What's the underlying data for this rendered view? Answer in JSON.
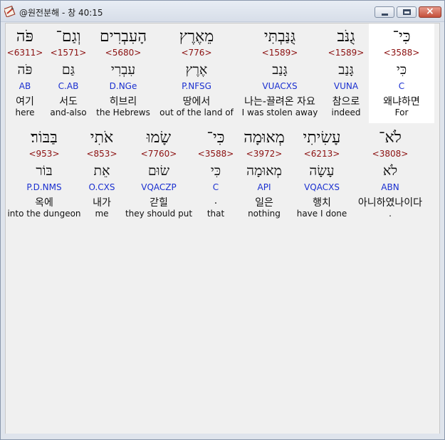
{
  "window": {
    "title": "@원전분해 - 창 40:15",
    "buttons": {
      "minimize": "minimize",
      "maximize": "maximize",
      "close": "×"
    }
  },
  "rows": [
    {
      "words": [
        {
          "heb": "כִּי־",
          "strong": "<3588>",
          "lex": "כִּי",
          "parse": "C",
          "kor": "왜냐하면",
          "eng": "For",
          "selected": true
        },
        {
          "heb": "גֻנֹּב",
          "strong": "<1589>",
          "lex": "גָּנַב",
          "parse": "VUNA",
          "kor": "참으로",
          "eng": "indeed"
        },
        {
          "heb": "גֻּנַּבְתִּי",
          "strong": "<1589>",
          "lex": "גָּנַב",
          "parse": "VUACXS",
          "kor": "나는-끌려온 자요",
          "eng": "I was stolen away"
        },
        {
          "heb": "מֵאֶרֶץ",
          "strong": "<776>",
          "lex": "אֶרֶץ",
          "parse": "P.NFSG",
          "kor": "땅에서",
          "eng": "out of the land of"
        },
        {
          "heb": "הָעִבְרִים",
          "strong": "<5680>",
          "lex": "עִבְרִי",
          "parse": "D.NGe",
          "kor": "히브리",
          "eng": "the Hebrews"
        },
        {
          "heb": "וְגַם־",
          "strong": "<1571>",
          "lex": "גַּם",
          "parse": "C.AB",
          "kor": "서도",
          "eng": "and-also"
        },
        {
          "heb": "פֹּה",
          "strong": "<6311>",
          "lex": "פֹּה",
          "parse": "AB",
          "kor": "여기",
          "eng": "here"
        }
      ]
    },
    {
      "words": [
        {
          "heb": "לֹא־",
          "strong": "<3808>",
          "lex": "לֹא",
          "parse": "ABN",
          "kor": "아니하였나이다",
          "eng": "."
        },
        {
          "heb": "עָשִׂיתִי",
          "strong": "<6213>",
          "lex": "עָשָׂה",
          "parse": "VQACXS",
          "kor": "행치",
          "eng": "have I done"
        },
        {
          "heb": "מְאוּמָה",
          "strong": "<3972>",
          "lex": "מְאוּמָה",
          "parse": "API",
          "kor": "일은",
          "eng": "nothing"
        },
        {
          "heb": "כִּי־",
          "strong": "<3588>",
          "lex": "כִּי",
          "parse": "C",
          "kor": ".",
          "eng": "that"
        },
        {
          "heb": "שָׂמוּ",
          "strong": "<7760>",
          "lex": "שׂוּם",
          "parse": "VQACZP",
          "kor": "갇힐",
          "eng": "they should put"
        },
        {
          "heb": "אֹתִי",
          "strong": "<853>",
          "lex": "אֵת",
          "parse": "O.CXS",
          "kor": "내가",
          "eng": "me"
        },
        {
          "heb": "בַּבּוֹר׃",
          "strong": "<953>",
          "lex": "בּוֹר",
          "parse": "P.D.NMS",
          "kor": "옥에",
          "eng": "into the dungeon"
        }
      ]
    }
  ]
}
